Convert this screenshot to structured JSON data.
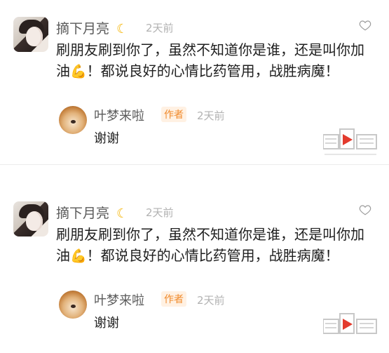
{
  "comments": [
    {
      "author": "摘下月亮",
      "time": "2天前",
      "text_part1": "刷朋友刷到你了，虽然不知道你是谁，还是叫你加油",
      "text_part2": "！都说良好的心情比药管用，战胜病魔！",
      "reply": {
        "author": "叶梦来啦",
        "badge": "作者",
        "time": "2天前",
        "text": "谢谢"
      }
    },
    {
      "author": "摘下月亮",
      "time": "2天前",
      "text_part1": "刷朋友刷到你了，虽然不知道你是谁，还是叫你加油",
      "text_part2": "！都说良好的心情比药管用，战胜病魔！",
      "reply": {
        "author": "叶梦来啦",
        "badge": "作者",
        "time": "2天前",
        "text": "谢谢"
      }
    }
  ],
  "icons": {
    "moon": "crescent-moon-emoji",
    "muscle": "flexed-biceps-emoji",
    "like": "heart-outline-icon"
  },
  "colors": {
    "author_badge": "#f08a2b",
    "time_gray": "#b2b2b2",
    "name_gray": "#5a5a5a"
  }
}
